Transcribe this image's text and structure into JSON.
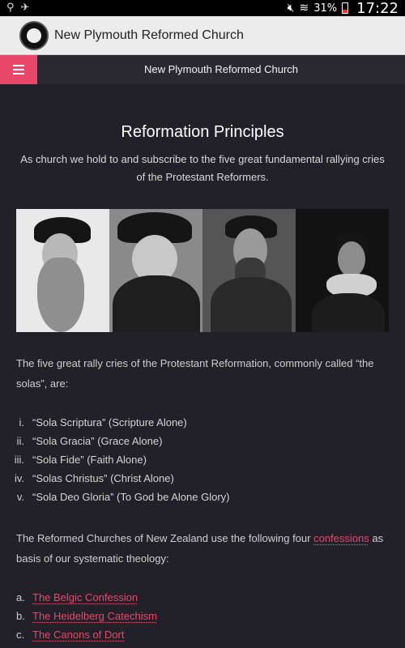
{
  "status_bar": {
    "battery_percent": "31%",
    "time": "17:22",
    "icons": [
      "usb-icon",
      "game-controller-icon",
      "mute-icon",
      "wifi-icon",
      "battery-icon"
    ]
  },
  "app_bar": {
    "title": "New Plymouth Reformed Church"
  },
  "site_nav": {
    "title": "New Plymouth Reformed Church",
    "accent_color": "#e8476a"
  },
  "content": {
    "title": "Reformation Principles",
    "intro": "As church we hold to and subscribe to the five great fundamental rallying cries of the Protestant Reformers.",
    "solas_intro": "The five great rally cries of the Protestant Reformation, commonly called “the solas”, are:",
    "solas": [
      {
        "num": "i.",
        "text": "“Sola Scriptura” (Scripture Alone)"
      },
      {
        "num": "ii.",
        "text": "“Sola Gracia” (Grace Alone)"
      },
      {
        "num": "iii.",
        "text": "“Sola Fide” (Faith Alone)"
      },
      {
        "num": "iv.",
        "text": "“Solas Christus” (Christ Alone)"
      },
      {
        "num": "v.",
        "text": "“Sola Deo Gloria” (To God be Alone Glory)"
      }
    ],
    "confessions_before": "The Reformed Churches of New Zealand use the following four ",
    "confessions_link": "confessions",
    "confessions_after": " as basis of our systematic theology:",
    "confessions": [
      {
        "num": "a.",
        "text": "The Belgic Confession"
      },
      {
        "num": "b.",
        "text": "The Heidelberg Catechism"
      },
      {
        "num": "c.",
        "text": "The Canons of Dort"
      }
    ]
  }
}
